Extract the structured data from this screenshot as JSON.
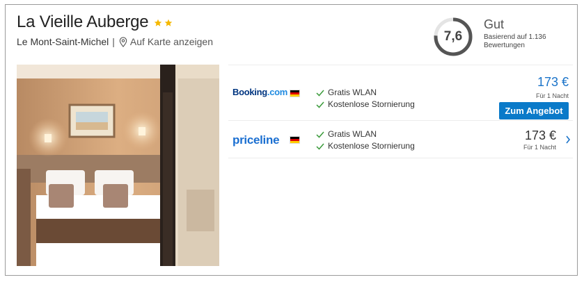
{
  "hotel": {
    "name": "La Vieille Auberge",
    "stars": 2,
    "location": "Le Mont-Saint-Michel",
    "separator": "|",
    "map_link": "Auf Karte anzeigen"
  },
  "rating": {
    "score": "7,6",
    "label": "Gut",
    "basis": "Basierend auf 1.136 Bewertungen",
    "ring_fill": 0.76
  },
  "offers": [
    {
      "provider": "Booking",
      "provider_suffix": ".com",
      "features": [
        "Gratis WLAN",
        "Kostenlose Stornierung"
      ],
      "price": "173 €",
      "per_night": "Für 1 Nacht",
      "button_label": "Zum Angebot"
    },
    {
      "provider": "priceline",
      "provider_suffix": "",
      "features": [
        "Gratis WLAN",
        "Kostenlose Stornierung"
      ],
      "price": "173 €",
      "per_night": "Für 1 Nacht"
    }
  ],
  "colors": {
    "accent": "#0a7ac9",
    "star": "#f5b800",
    "check": "#3a9a3a",
    "rating_ring": "#555555"
  }
}
